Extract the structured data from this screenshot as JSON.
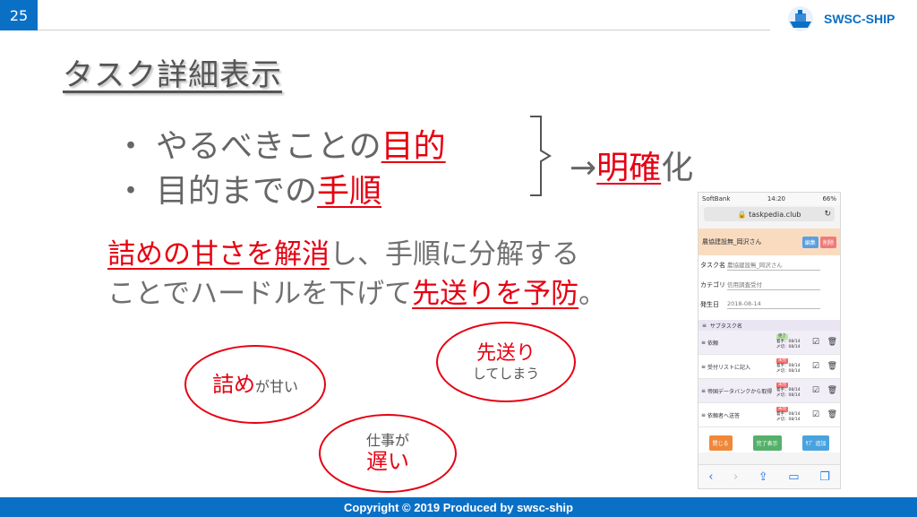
{
  "slide": {
    "page_number": "25",
    "logo_text": "SWSC-SHIP",
    "title": "タスク詳細表示",
    "footer": "Copyright © 2019 Produced by swsc-ship"
  },
  "bullets": [
    {
      "prefix": "・",
      "plain": "やるべきことの",
      "highlight": "目的"
    },
    {
      "prefix": "・",
      "plain": "目的までの",
      "highlight": "手順"
    }
  ],
  "clarify": {
    "arrow": "→",
    "highlight": "明確",
    "rest": "化"
  },
  "paragraph": {
    "line1_highlight": "詰めの甘さを解消",
    "line1_rest": "し、手順に分解する",
    "line2_plain": "ことでハードルを下げて",
    "line2_highlight": "先送りを予防",
    "line2_end": "。"
  },
  "bubbles": {
    "b1": {
      "big": "詰め",
      "small": "が甘い"
    },
    "b2": {
      "big": "先送り",
      "small": "してしまう"
    },
    "b3": {
      "small": "仕事が",
      "big": "遅い"
    }
  },
  "phone": {
    "carrier": "SoftBank",
    "time": "14:20",
    "battery": "66%",
    "url": "taskpedia.club",
    "header_title": "農協建設無_岡沢さん",
    "btn_edit": "編集",
    "btn_delete": "削除",
    "fields": [
      {
        "label": "タスク名",
        "value": "農協建設無_岡沢さん"
      },
      {
        "label": "カテゴリ",
        "value": "信用調査受付"
      },
      {
        "label": "発生日",
        "value": "2018-08-14"
      }
    ],
    "subtask_header": "サブタスク名",
    "subtasks": [
      {
        "name": "依頼",
        "status": "完了",
        "start": "着手：08/14",
        "due": "〆切：08/14"
      },
      {
        "name": "受付リストに記入",
        "status": "未完",
        "start": "着手：08/14",
        "due": "〆切：08/14"
      },
      {
        "name": "帝国データバンクから取得",
        "status": "未完",
        "start": "着手：08/14",
        "due": "〆切：08/14"
      },
      {
        "name": "依頼者へ送答",
        "status": "未完",
        "start": "着手：08/14",
        "due": "〆切：08/14"
      }
    ],
    "btn_close": "閉じる",
    "btn_done_view": "完了表示",
    "btn_add": "ｻﾌﾞ 追加",
    "colors": {
      "accent": "#e60012",
      "brand": "#0a70c6",
      "header_bg": "#f9dcc0"
    }
  }
}
